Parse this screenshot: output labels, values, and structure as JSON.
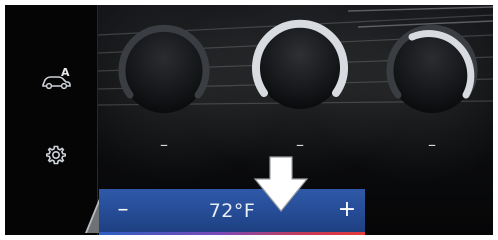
{
  "sidebar": {
    "items": [
      {
        "icon": "car-a-icon",
        "label": "A"
      },
      {
        "icon": "gear-icon"
      }
    ]
  },
  "dials": [
    {
      "id": "left",
      "label": "–"
    },
    {
      "id": "center",
      "label": "–"
    },
    {
      "id": "right",
      "label": "–"
    }
  ],
  "bottom_bar": {
    "minus_label": "–",
    "temperature": "72°F",
    "plus_label": "+"
  },
  "callout": {
    "icon": "down-arrow-icon"
  },
  "colors": {
    "accent_blue": "#2f59a8",
    "heat_red": "#e23a3a",
    "dial_silver": "#d8dbe0"
  }
}
